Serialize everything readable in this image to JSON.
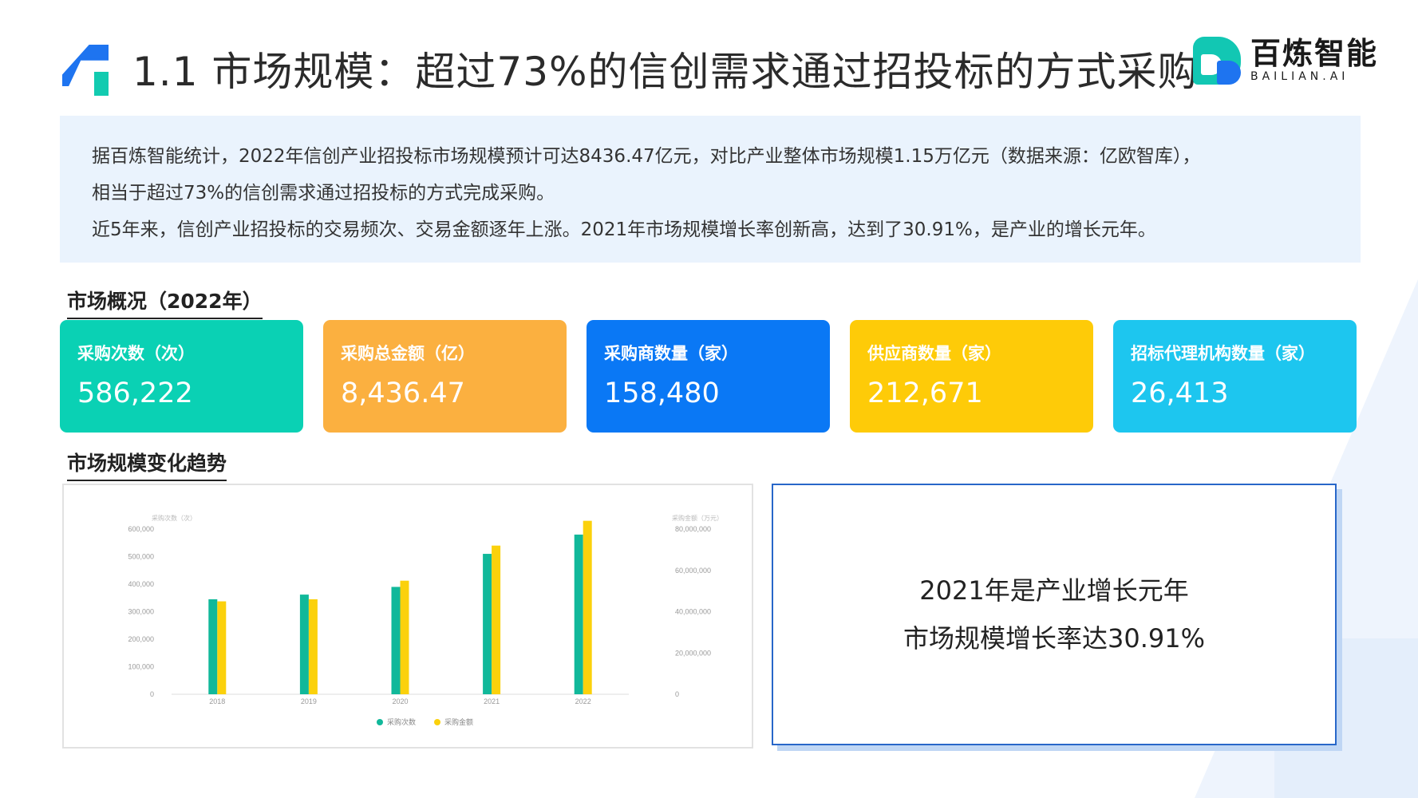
{
  "header": {
    "title": "1.1 市场规模：超过73%的信创需求通过招投标的方式采购"
  },
  "brand": {
    "name_cn": "百炼智能",
    "name_en": "BAILIAN.AI"
  },
  "summary": {
    "lines": [
      "据百炼智能统计，2022年信创产业招投标市场规模预计可达8436.47亿元，对比产业整体市场规模1.15万亿元（数据来源：亿欧智库），",
      "相当于超过73%的信创需求通过招投标的方式完成采购。",
      "近5年来，信创产业招投标的交易频次、交易金额逐年上涨。2021年市场规模增长率创新高，达到了30.91%，是产业的增长元年。"
    ]
  },
  "overview": {
    "title": "市场概况（2022年）",
    "cards": [
      {
        "label": "采购次数（次）",
        "value": "586,222",
        "color": "#0ad1b4"
      },
      {
        "label": "采购总金额（亿）",
        "value": "8,436.47",
        "color": "#fbb040"
      },
      {
        "label": "采购商数量（家）",
        "value": "158,480",
        "color": "#0a78f5"
      },
      {
        "label": "供应商数量（家）",
        "value": "212,671",
        "color": "#fecb08"
      },
      {
        "label": "招标代理机构数量（家）",
        "value": "26,413",
        "color": "#1dc6ef"
      }
    ]
  },
  "trend": {
    "title": "市场规模变化趋势"
  },
  "callout": {
    "line1": "2021年是产业增长元年",
    "line2": "市场规模增长率达30.91%"
  },
  "chart_data": {
    "type": "bar",
    "categories": [
      "2018",
      "2019",
      "2020",
      "2021",
      "2022"
    ],
    "series": [
      {
        "name": "采购次数",
        "axis": "left",
        "color": "#11b89a",
        "values": [
          345000,
          362000,
          390000,
          510000,
          580000
        ]
      },
      {
        "name": "采购金额",
        "axis": "right",
        "color": "#fbd10c",
        "values": [
          45000000,
          46000000,
          55000000,
          72000000,
          84000000
        ]
      }
    ],
    "y_left": {
      "label": "采购次数（次）",
      "ylim": [
        0,
        600000
      ],
      "ticks": [
        "600,000",
        "500,000",
        "400,000",
        "300,000",
        "200,000",
        "100,000",
        "0"
      ]
    },
    "y_right": {
      "label": "采购金额（万元）",
      "ylim": [
        0,
        80000000
      ],
      "ticks": [
        "80,000,000",
        "60,000,000",
        "40,000,000",
        "20,000,000",
        "0"
      ]
    },
    "legend": "bottom-center",
    "grid": false
  }
}
